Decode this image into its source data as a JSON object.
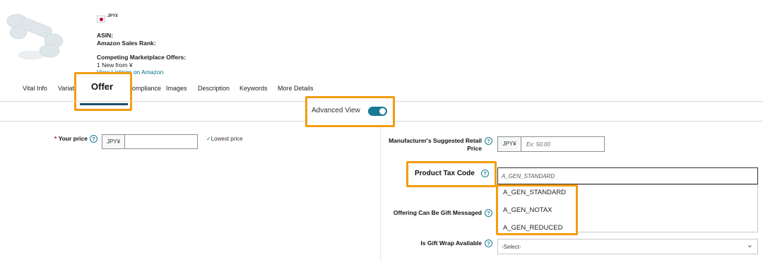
{
  "product": {
    "currency": "JPY¥",
    "asin_label": "ASIN:",
    "sales_rank_label": "Amazon Sales Rank:",
    "competing_offers_label": "Competing Marketplace Offers:",
    "offers_summary": "1 New from ¥",
    "view_listings_link": "View Listings on Amazon"
  },
  "tabs": [
    {
      "label": "Vital Info"
    },
    {
      "label": "Variati"
    },
    {
      "label": "Offer",
      "active": true
    },
    {
      "label": "ompliance"
    },
    {
      "label": "Images"
    },
    {
      "label": "Description"
    },
    {
      "label": "Keywords"
    },
    {
      "label": "More Details"
    }
  ],
  "advanced_view": {
    "label": "Advanced View",
    "enabled": true
  },
  "fields": {
    "your_price": {
      "required_mark": "*",
      "label": "Your price",
      "currency": "JPY¥",
      "value": "",
      "lowest_price": "Lowest price"
    },
    "msrp": {
      "label_line1": "Manufacturer's Suggested Retail",
      "label_line2": "Price",
      "currency": "JPY¥",
      "placeholder": "Ex: 50.00"
    },
    "tax_code": {
      "label": "Product Tax Code",
      "value": "A_GEN_STANDARD",
      "options": [
        "A_GEN_STANDARD",
        "A_GEN_NOTAX",
        "A_GEN_REDUCED"
      ]
    },
    "gift_message": {
      "label": "Offering Can Be Gift Messaged"
    },
    "gift_wrap": {
      "label": "Is Gift Wrap Available",
      "selected": "-Select-"
    }
  },
  "icons": {
    "help": "?",
    "check": "✓",
    "chevron": "⌄"
  },
  "colors": {
    "highlight": "#f39c12",
    "toggle": "#1a7a95",
    "link": "#007185"
  }
}
